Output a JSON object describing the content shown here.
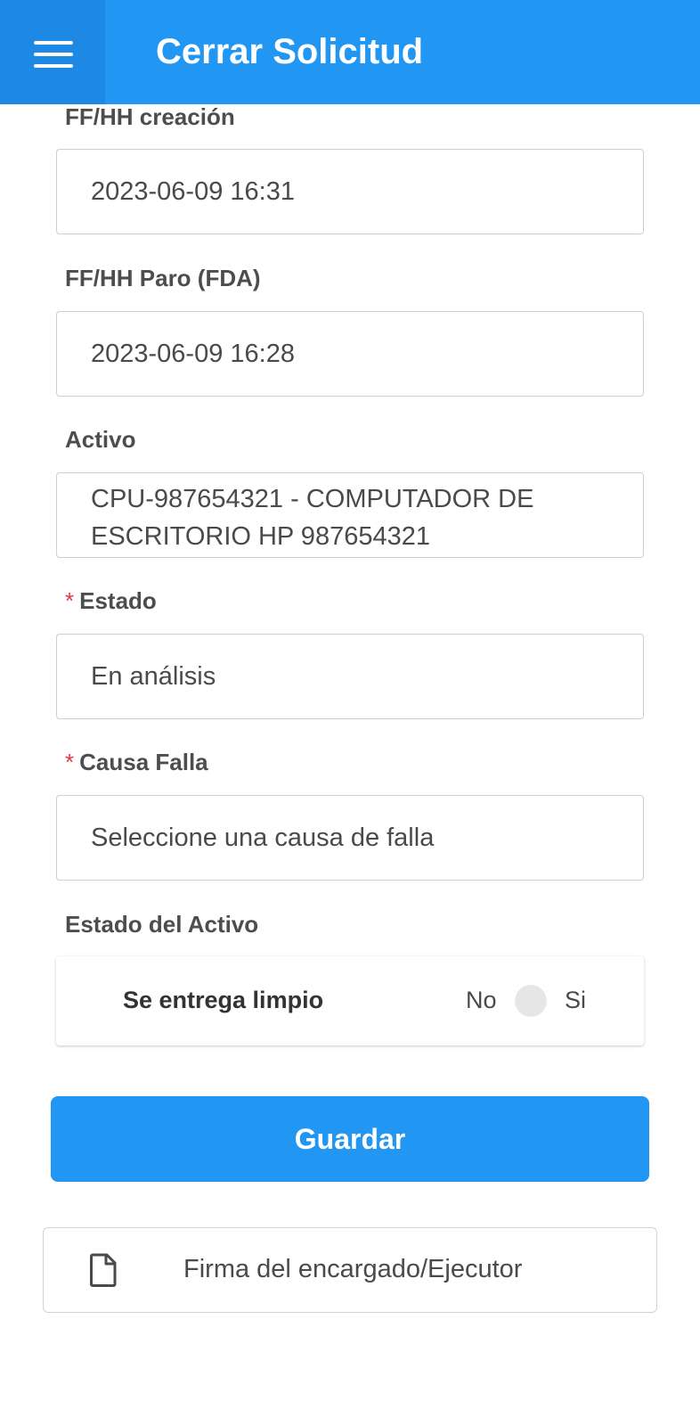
{
  "header": {
    "title": "Cerrar Solicitud",
    "menu_icon": "hamburger-menu-icon",
    "background": "#2196f3",
    "menu_background": "#1e88e5"
  },
  "form": {
    "creation": {
      "label": "FF/HH creación",
      "value": "2023-06-09 16:31"
    },
    "stop": {
      "label": "FF/HH Paro (FDA)",
      "value": "2023-06-09 16:28"
    },
    "asset": {
      "label": "Activo",
      "value": "CPU-987654321 - COMPUTADOR DE ESCRITORIO HP 987654321"
    },
    "status": {
      "required_mark": "*",
      "label": "Estado",
      "value": "En análisis"
    },
    "failure_cause": {
      "required_mark": "*",
      "label": "Causa Falla",
      "placeholder": "Seleccione una causa de falla"
    },
    "asset_state": {
      "label": "Estado del Activo",
      "clean_delivery": {
        "label": "Se entrega limpio",
        "off_label": "No",
        "on_label": "Si",
        "checked": false
      }
    }
  },
  "actions": {
    "save_label": "Guardar",
    "signature_label": "Firma del encargado/Ejecutor",
    "signature_icon": "document-icon"
  },
  "colors": {
    "accent": "#2196f3",
    "required": "#e0393e"
  }
}
